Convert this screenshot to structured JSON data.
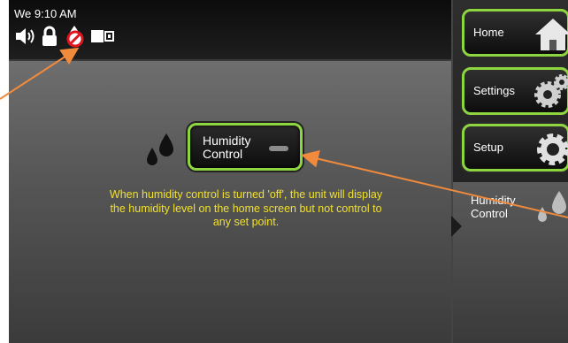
{
  "status": {
    "time": "We 9:10 AM",
    "icons": [
      "speaker-icon",
      "padlock-icon",
      "humidity-off-icon",
      "battery-icon"
    ]
  },
  "main": {
    "humidity_button": {
      "line1": "Humidity",
      "line2": "Control",
      "state": "off"
    },
    "note": "When humidity control is turned 'off', the unit will display the humidity level on the home screen but not control to any set point."
  },
  "sidebar": {
    "home": "Home",
    "settings": "Settings",
    "setup": "Setup",
    "selected": {
      "line1": "Humidity",
      "line2": "Control"
    }
  },
  "colors": {
    "accent": "#8ed640",
    "note_text": "#f0e030",
    "callout_arrow": "#f08a3c"
  }
}
